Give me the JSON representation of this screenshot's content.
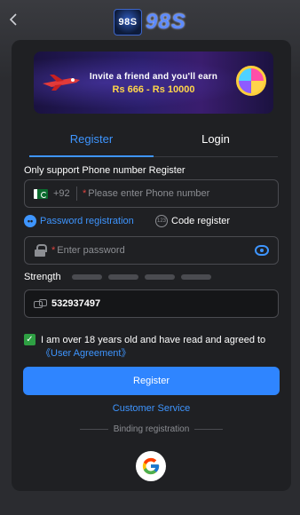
{
  "header": {
    "back_icon": "chevron-left-icon",
    "logo_small": "98S",
    "logo_big": "98S"
  },
  "banner": {
    "line1": "Invite a friend and you'll earn",
    "line2": "Rs 666 - Rs 10000"
  },
  "tabs": [
    {
      "label": "Register",
      "active": true
    },
    {
      "label": "Login",
      "active": false
    }
  ],
  "phone": {
    "section_label": "Only support Phone number Register",
    "country_code": "+92",
    "required_mark": "*",
    "placeholder": "Please enter Phone number"
  },
  "modes": {
    "password_registration": "Password registration",
    "code_register": "Code register",
    "code_icon_text": "123"
  },
  "password": {
    "required_mark": "*",
    "placeholder": "Enter password"
  },
  "strength": {
    "label": "Strength",
    "bar_count": 4
  },
  "invite": {
    "value": "532937497"
  },
  "agreement": {
    "checked": true,
    "checkmark": "✓",
    "text": "I am over 18 years old and have read and agreed to",
    "link": "《User Agreement》"
  },
  "actions": {
    "register_button": "Register",
    "customer_service": "Customer Service",
    "binding_registration": "Binding registration"
  },
  "colors": {
    "accent": "#2f85ff",
    "link": "#3e95ff",
    "check": "#2ea043",
    "required": "#e0443f",
    "card": "#1f2023"
  }
}
